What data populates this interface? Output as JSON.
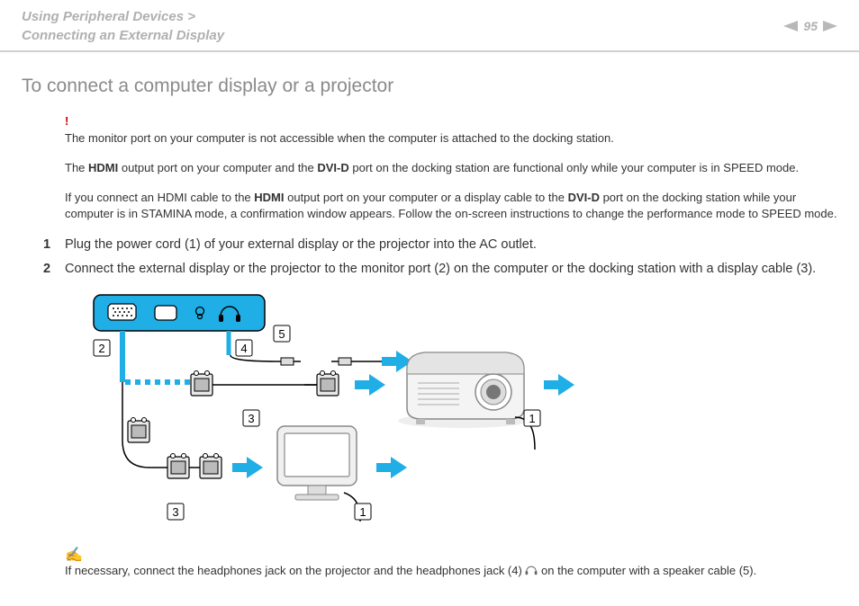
{
  "breadcrumb": {
    "line1": "Using Peripheral Devices >",
    "line2": "Connecting an External Display"
  },
  "page_number": "95",
  "heading": "To connect a computer display or a projector",
  "warning": {
    "mark": "!",
    "line1": "The monitor port on your computer is not accessible when the computer is attached to the docking station.",
    "line2_pre": "The ",
    "line2_b1": "HDMI",
    "line2_mid": " output port on your computer and the ",
    "line2_b2": "DVI-D",
    "line2_post": " port on the docking station are functional only while your computer is in SPEED mode.",
    "line3_pre": "If you connect an HDMI cable to the ",
    "line3_b1": "HDMI",
    "line3_mid": " output port on your computer or a display cable to the ",
    "line3_b2": "DVI-D",
    "line3_post": " port on the docking station while your computer is in STAMINA mode, a confirmation window appears. Follow the on-screen instructions to change the performance mode to SPEED mode."
  },
  "steps": {
    "s1": "Plug the power cord (1) of your external display or the projector into the AC outlet.",
    "s2": "Connect the external display or the projector to the monitor port (2) on the computer or the docking station with a display cable (3)."
  },
  "diagram": {
    "labels": {
      "l1": "1",
      "l2": "2",
      "l3": "3",
      "l4": "4",
      "l5": "5"
    }
  },
  "tip": {
    "pre": "If necessary, connect the headphones jack on the projector and the headphones jack (4) ",
    "post": " on the computer with a speaker cable (5)."
  }
}
